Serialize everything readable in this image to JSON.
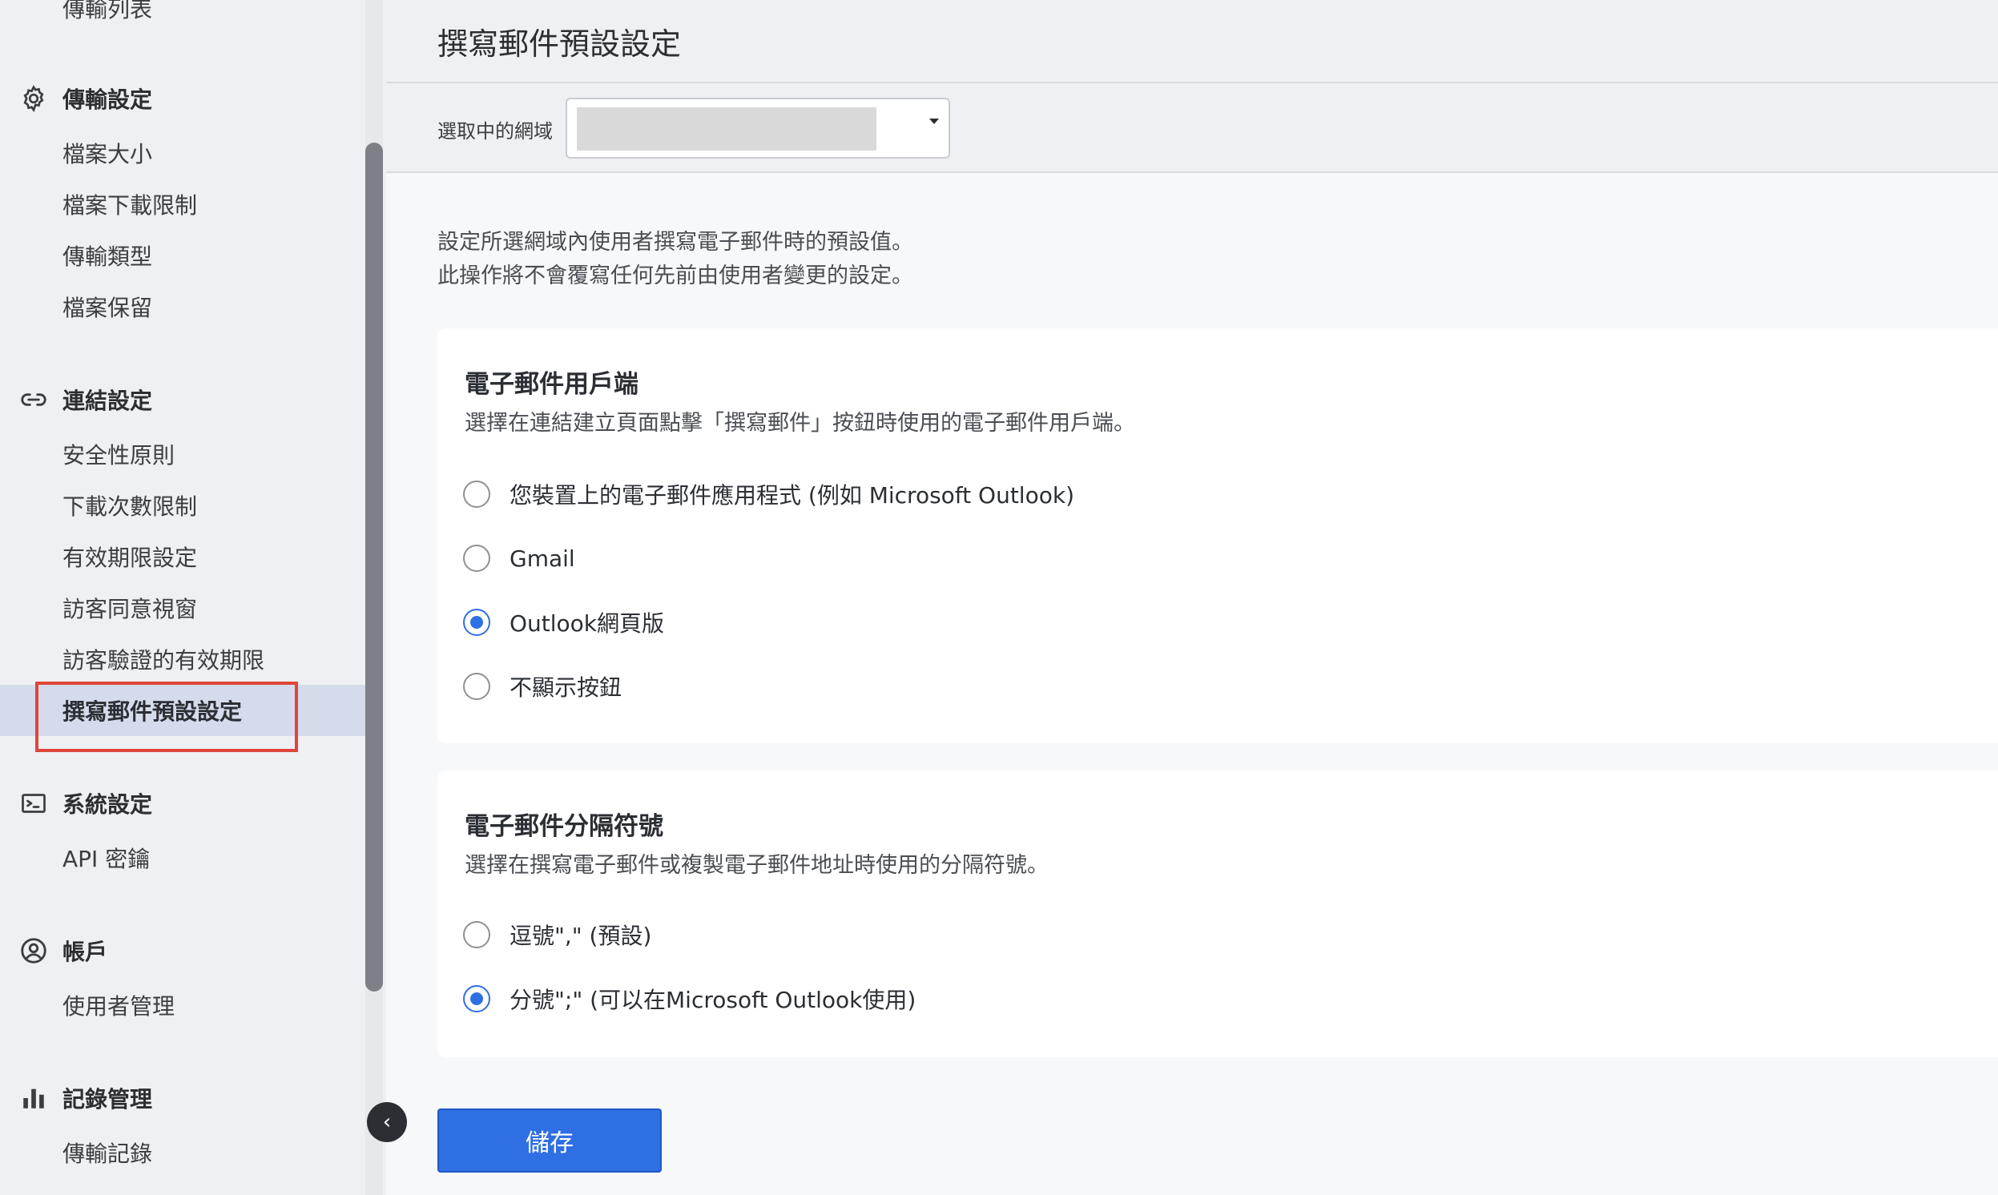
{
  "sidebar": {
    "top_item": "傳輸列表",
    "groups": [
      {
        "icon": "gear-icon",
        "title": "傳輸設定",
        "items": [
          "檔案大小",
          "檔案下載限制",
          "傳輸類型",
          "檔案保留"
        ]
      },
      {
        "icon": "link-icon",
        "title": "連結設定",
        "items": [
          "安全性原則",
          "下載次數限制",
          "有效期限設定",
          "訪客同意視窗",
          "訪客驗證的有效期限",
          "撰寫郵件預設設定"
        ]
      },
      {
        "icon": "terminal-icon",
        "title": "系統設定",
        "items": [
          "API 密鑰"
        ]
      },
      {
        "icon": "user-circle-icon",
        "title": "帳戶",
        "items": [
          "使用者管理"
        ]
      },
      {
        "icon": "bar-chart-icon",
        "title": "記錄管理",
        "items": [
          "傳輸記錄"
        ]
      }
    ],
    "active_item": "撰寫郵件預設設定"
  },
  "main": {
    "title": "撰寫郵件預設設定",
    "domain_label": "選取中的網域",
    "description_line1": "設定所選網域內使用者撰寫電子郵件時的預設值。",
    "description_line2": "此操作將不會覆寫任何先前由使用者變更的設定。",
    "client_card": {
      "title": "電子郵件用戶端",
      "subtitle": "選擇在連結建立頁面點擊「撰寫郵件」按鈕時使用的電子郵件用戶端。",
      "options": [
        {
          "label": "您裝置上的電子郵件應用程式 (例如 Microsoft Outlook)",
          "checked": false
        },
        {
          "label": "Gmail",
          "checked": false
        },
        {
          "label": "Outlook網頁版",
          "checked": true
        },
        {
          "label": "不顯示按鈕",
          "checked": false
        }
      ]
    },
    "separator_card": {
      "title": "電子郵件分隔符號",
      "subtitle": "選擇在撰寫電子郵件或複製電子郵件地址時使用的分隔符號。",
      "options": [
        {
          "label": "逗號\",\" (預設)",
          "checked": false
        },
        {
          "label": "分號\";\" (可以在Microsoft Outlook使用)",
          "checked": true
        }
      ]
    },
    "save_label": "儲存"
  },
  "colors": {
    "accent": "#2f6fe4",
    "active_nav_bg": "#d4dcec",
    "highlight_outline": "#e0463a"
  }
}
